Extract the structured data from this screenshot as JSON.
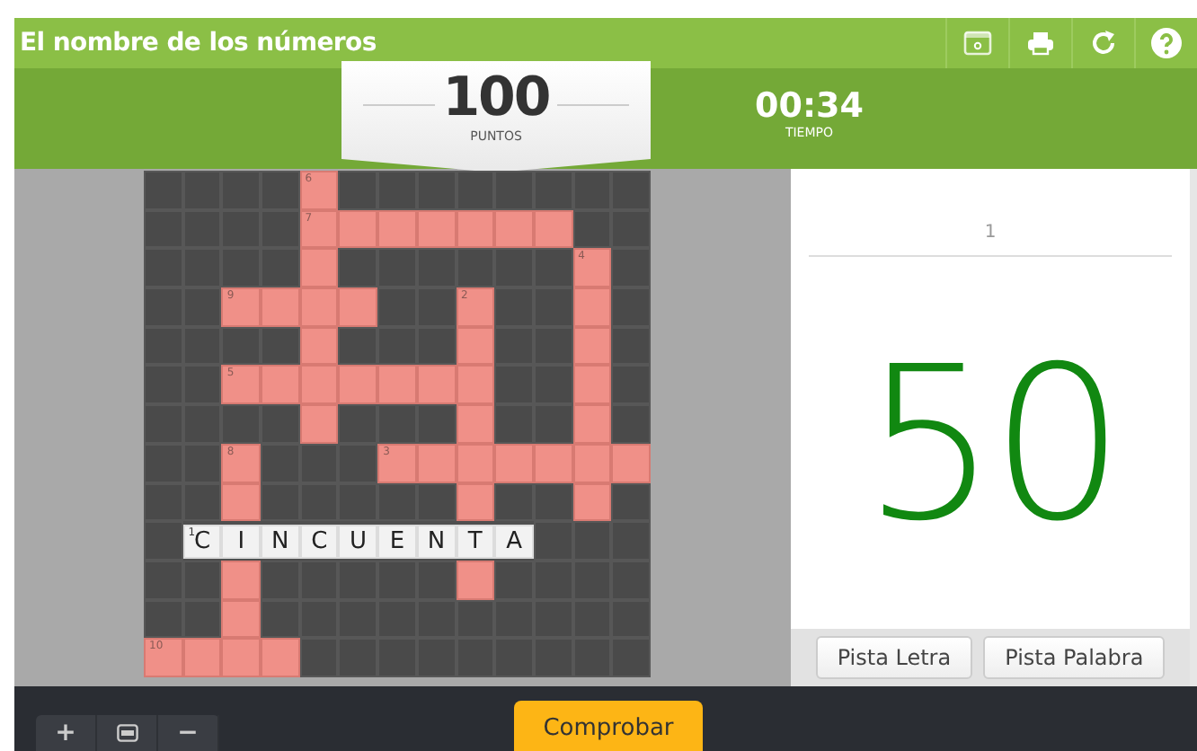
{
  "window": {
    "title": "El nombre de los números"
  },
  "toolbar": {
    "buttons": [
      {
        "kind": "fullscreen"
      },
      {
        "kind": "print"
      },
      {
        "kind": "restart"
      },
      {
        "kind": "help"
      }
    ]
  },
  "score": {
    "value": "100",
    "label": "PUNTOS"
  },
  "timer": {
    "value": "00:34",
    "label": "TIEMPO"
  },
  "crossword": {
    "rows": [
      [
        {
          "kind": "block"
        },
        {
          "kind": "block"
        },
        {
          "kind": "block"
        },
        {
          "kind": "block"
        },
        {
          "kind": "open",
          "number": "6"
        },
        {
          "kind": "block"
        },
        {
          "kind": "block"
        },
        {
          "kind": "block"
        },
        {
          "kind": "block"
        },
        {
          "kind": "block"
        },
        {
          "kind": "block"
        },
        {
          "kind": "block"
        },
        {
          "kind": "block"
        }
      ],
      [
        {
          "kind": "block"
        },
        {
          "kind": "block"
        },
        {
          "kind": "block"
        },
        {
          "kind": "block"
        },
        {
          "kind": "open",
          "number": "7"
        },
        {
          "kind": "open"
        },
        {
          "kind": "open"
        },
        {
          "kind": "open"
        },
        {
          "kind": "open"
        },
        {
          "kind": "open"
        },
        {
          "kind": "open"
        },
        {
          "kind": "block"
        },
        {
          "kind": "block"
        }
      ],
      [
        {
          "kind": "block"
        },
        {
          "kind": "block"
        },
        {
          "kind": "block"
        },
        {
          "kind": "block"
        },
        {
          "kind": "open"
        },
        {
          "kind": "block"
        },
        {
          "kind": "block"
        },
        {
          "kind": "block"
        },
        {
          "kind": "block"
        },
        {
          "kind": "block"
        },
        {
          "kind": "block"
        },
        {
          "kind": "open",
          "number": "4"
        },
        {
          "kind": "block"
        }
      ],
      [
        {
          "kind": "block"
        },
        {
          "kind": "block"
        },
        {
          "kind": "open",
          "number": "9"
        },
        {
          "kind": "open"
        },
        {
          "kind": "open"
        },
        {
          "kind": "open"
        },
        {
          "kind": "block"
        },
        {
          "kind": "block"
        },
        {
          "kind": "open",
          "number": "2"
        },
        {
          "kind": "block"
        },
        {
          "kind": "block"
        },
        {
          "kind": "open"
        },
        {
          "kind": "block"
        }
      ],
      [
        {
          "kind": "block"
        },
        {
          "kind": "block"
        },
        {
          "kind": "block"
        },
        {
          "kind": "block"
        },
        {
          "kind": "open"
        },
        {
          "kind": "block"
        },
        {
          "kind": "block"
        },
        {
          "kind": "block"
        },
        {
          "kind": "open"
        },
        {
          "kind": "block"
        },
        {
          "kind": "block"
        },
        {
          "kind": "open"
        },
        {
          "kind": "block"
        }
      ],
      [
        {
          "kind": "block"
        },
        {
          "kind": "block"
        },
        {
          "kind": "open",
          "number": "5"
        },
        {
          "kind": "open"
        },
        {
          "kind": "open"
        },
        {
          "kind": "open"
        },
        {
          "kind": "open"
        },
        {
          "kind": "open"
        },
        {
          "kind": "open"
        },
        {
          "kind": "block"
        },
        {
          "kind": "block"
        },
        {
          "kind": "open"
        },
        {
          "kind": "block"
        }
      ],
      [
        {
          "kind": "block"
        },
        {
          "kind": "block"
        },
        {
          "kind": "block"
        },
        {
          "kind": "block"
        },
        {
          "kind": "open"
        },
        {
          "kind": "block"
        },
        {
          "kind": "block"
        },
        {
          "kind": "block"
        },
        {
          "kind": "open"
        },
        {
          "kind": "block"
        },
        {
          "kind": "block"
        },
        {
          "kind": "open"
        },
        {
          "kind": "block"
        }
      ],
      [
        {
          "kind": "block"
        },
        {
          "kind": "block"
        },
        {
          "kind": "open",
          "number": "8"
        },
        {
          "kind": "block"
        },
        {
          "kind": "block"
        },
        {
          "kind": "block"
        },
        {
          "kind": "open",
          "number": "3"
        },
        {
          "kind": "open"
        },
        {
          "kind": "open"
        },
        {
          "kind": "open"
        },
        {
          "kind": "open"
        },
        {
          "kind": "open"
        },
        {
          "kind": "open"
        }
      ],
      [
        {
          "kind": "block"
        },
        {
          "kind": "block"
        },
        {
          "kind": "open"
        },
        {
          "kind": "block"
        },
        {
          "kind": "block"
        },
        {
          "kind": "block"
        },
        {
          "kind": "block"
        },
        {
          "kind": "block"
        },
        {
          "kind": "open"
        },
        {
          "kind": "block"
        },
        {
          "kind": "block"
        },
        {
          "kind": "open"
        },
        {
          "kind": "block"
        }
      ],
      [
        {
          "kind": "block"
        },
        {
          "kind": "active",
          "number": "1",
          "letter": "C"
        },
        {
          "kind": "active",
          "letter": "I"
        },
        {
          "kind": "active",
          "letter": "N"
        },
        {
          "kind": "active",
          "letter": "C"
        },
        {
          "kind": "active",
          "letter": "U"
        },
        {
          "kind": "active",
          "letter": "E"
        },
        {
          "kind": "active",
          "letter": "N"
        },
        {
          "kind": "active",
          "letter": "T"
        },
        {
          "kind": "active",
          "letter": "A"
        },
        {
          "kind": "block"
        },
        {
          "kind": "block"
        },
        {
          "kind": "block"
        }
      ],
      [
        {
          "kind": "block"
        },
        {
          "kind": "block"
        },
        {
          "kind": "open"
        },
        {
          "kind": "block"
        },
        {
          "kind": "block"
        },
        {
          "kind": "block"
        },
        {
          "kind": "block"
        },
        {
          "kind": "block"
        },
        {
          "kind": "open"
        },
        {
          "kind": "block"
        },
        {
          "kind": "block"
        },
        {
          "kind": "block"
        },
        {
          "kind": "block"
        }
      ],
      [
        {
          "kind": "block"
        },
        {
          "kind": "block"
        },
        {
          "kind": "open"
        },
        {
          "kind": "block"
        },
        {
          "kind": "block"
        },
        {
          "kind": "block"
        },
        {
          "kind": "block"
        },
        {
          "kind": "block"
        },
        {
          "kind": "block"
        },
        {
          "kind": "block"
        },
        {
          "kind": "block"
        },
        {
          "kind": "block"
        },
        {
          "kind": "block"
        }
      ],
      [
        {
          "kind": "open",
          "number": "10"
        },
        {
          "kind": "open"
        },
        {
          "kind": "open"
        },
        {
          "kind": "open"
        },
        {
          "kind": "block"
        },
        {
          "kind": "block"
        },
        {
          "kind": "block"
        },
        {
          "kind": "block"
        },
        {
          "kind": "block"
        },
        {
          "kind": "block"
        },
        {
          "kind": "block"
        },
        {
          "kind": "block"
        },
        {
          "kind": "block"
        }
      ]
    ]
  },
  "clue": {
    "number": "1",
    "content": "50",
    "buttons": [
      "Pista Letra",
      "Pista Palabra"
    ]
  },
  "footer": {
    "zoom": [
      {
        "kind": "plus",
        "label": "+"
      },
      {
        "kind": "fit"
      },
      {
        "kind": "minus",
        "label": "−"
      }
    ],
    "check_button": "Comprobar"
  }
}
